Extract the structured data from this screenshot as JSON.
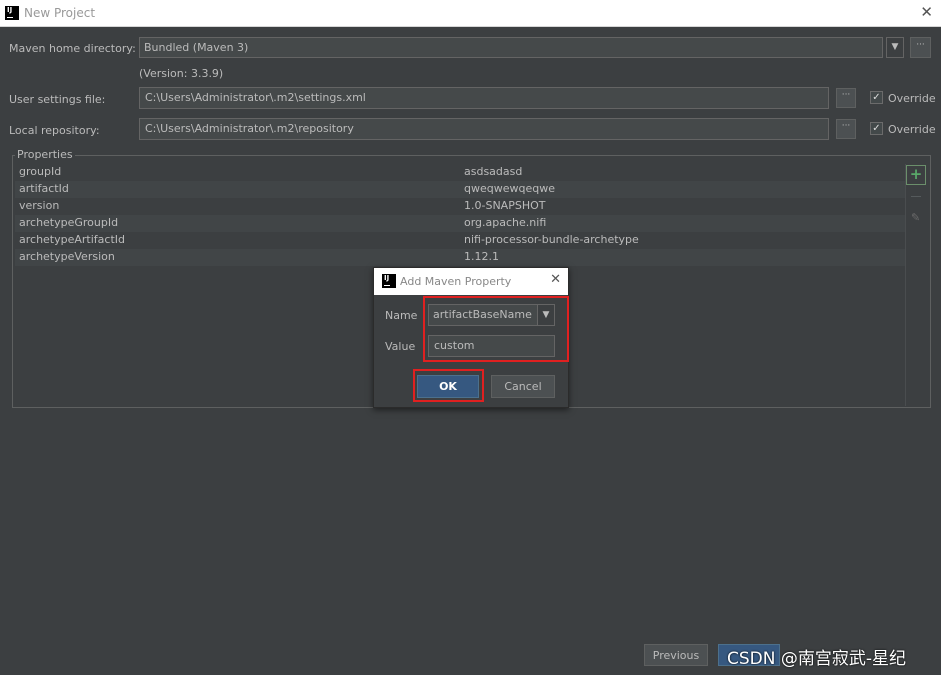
{
  "window": {
    "title": "New Project",
    "icon": "intellij-icon"
  },
  "maven_home": {
    "label": "Maven home directory:",
    "value": "Bundled (Maven 3)",
    "version": "(Version: 3.3.9)"
  },
  "user_settings": {
    "label": "User settings file:",
    "value": "C:\\Users\\Administrator\\.m2\\settings.xml",
    "override_label": "Override",
    "override_checked": true
  },
  "local_repo": {
    "label": "Local repository:",
    "value": "C:\\Users\\Administrator\\.m2\\repository",
    "override_label": "Override",
    "override_checked": true
  },
  "properties": {
    "title": "Properties",
    "rows": [
      {
        "key": "groupId",
        "value": "asdsadasd"
      },
      {
        "key": "artifactId",
        "value": "qweqwewqeqwe"
      },
      {
        "key": "version",
        "value": "1.0-SNAPSHOT"
      },
      {
        "key": "archetypeGroupId",
        "value": "org.apache.nifi"
      },
      {
        "key": "archetypeArtifactId",
        "value": "nifi-processor-bundle-archetype"
      },
      {
        "key": "archetypeVersion",
        "value": "1.12.1"
      }
    ]
  },
  "dialog": {
    "title": "Add Maven Property",
    "name_label": "Name",
    "name_value": "artifactBaseName",
    "value_label": "Value",
    "value_value": "custom",
    "ok_label": "OK",
    "cancel_label": "Cancel"
  },
  "footer": {
    "previous_label": "Previous"
  },
  "watermark": "CSDN @南宫寂武-星纪",
  "colors": {
    "background": "#3c3f41",
    "highlight": "#e02020",
    "primary_button": "#365880",
    "add_icon": "#59a869"
  }
}
